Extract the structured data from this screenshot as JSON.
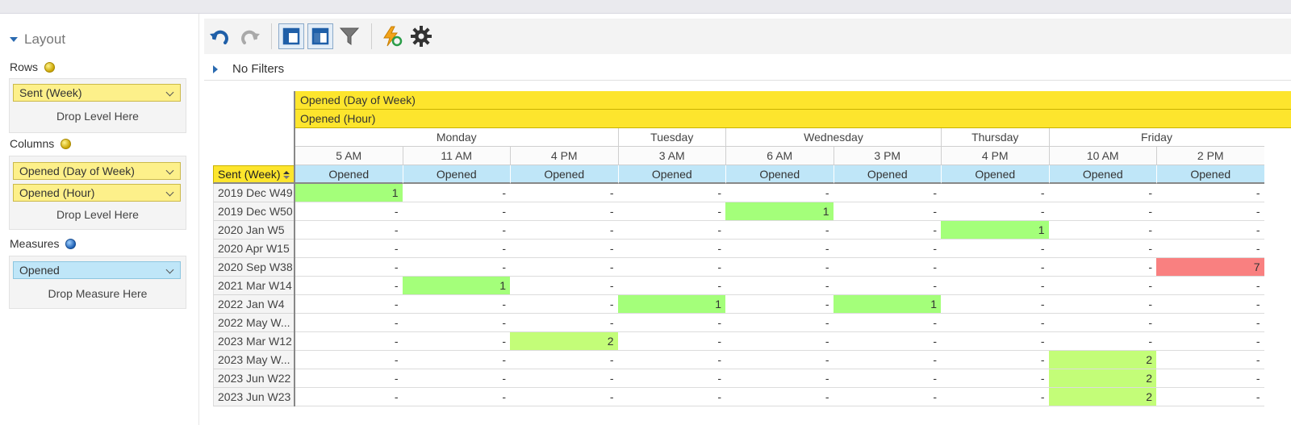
{
  "layout_panel": {
    "title": "Layout",
    "rows": {
      "label": "Rows",
      "chips": [
        "Sent (Week)"
      ],
      "drop_hint": "Drop Level Here"
    },
    "columns": {
      "label": "Columns",
      "chips": [
        "Opened (Day of Week)",
        "Opened (Hour)"
      ],
      "drop_hint": "Drop Level Here"
    },
    "measures": {
      "label": "Measures",
      "chips": [
        "Opened"
      ],
      "drop_hint": "Drop Measure Here"
    }
  },
  "toolbar": {
    "icons": [
      "undo-icon",
      "redo-icon",
      "compact-layout-icon",
      "tabular-layout-icon",
      "filter-icon",
      "refresh-icon",
      "settings-icon"
    ]
  },
  "filters": {
    "label": "No Filters"
  },
  "pivot": {
    "column_level_1": "Opened (Day of Week)",
    "column_level_2": "Opened (Hour)",
    "row_header": "Sent (Week)",
    "days": [
      {
        "name": "Monday",
        "span": 3
      },
      {
        "name": "Tuesday",
        "span": 1
      },
      {
        "name": "Wednesday",
        "span": 2
      },
      {
        "name": "Thursday",
        "span": 1
      },
      {
        "name": "Friday",
        "span": 2
      }
    ],
    "hours": [
      "5 AM",
      "11 AM",
      "4 PM",
      "3 AM",
      "6 AM",
      "3 PM",
      "4 PM",
      "10 AM",
      "2 PM"
    ],
    "measure": "Opened",
    "rows": [
      {
        "label": "2019 Dec W49",
        "values": [
          "1",
          "-",
          "-",
          "-",
          "-",
          "-",
          "-",
          "-",
          "-"
        ]
      },
      {
        "label": "2019 Dec W50",
        "values": [
          "-",
          "-",
          "-",
          "-",
          "1",
          "-",
          "-",
          "-",
          "-"
        ]
      },
      {
        "label": "2020 Jan W5",
        "values": [
          "-",
          "-",
          "-",
          "-",
          "-",
          "-",
          "1",
          "-",
          "-"
        ]
      },
      {
        "label": "2020 Apr W15",
        "values": [
          "-",
          "-",
          "-",
          "-",
          "-",
          "-",
          "-",
          "-",
          "-"
        ]
      },
      {
        "label": "2020 Sep W38",
        "values": [
          "-",
          "-",
          "-",
          "-",
          "-",
          "-",
          "-",
          "-",
          "7"
        ]
      },
      {
        "label": "2021 Mar W14",
        "values": [
          "-",
          "1",
          "-",
          "-",
          "-",
          "-",
          "-",
          "-",
          "-"
        ]
      },
      {
        "label": "2022 Jan W4",
        "values": [
          "-",
          "-",
          "-",
          "1",
          "-",
          "1",
          "-",
          "-",
          "-"
        ]
      },
      {
        "label": "2022 May W...",
        "values": [
          "-",
          "-",
          "-",
          "-",
          "-",
          "-",
          "-",
          "-",
          "-"
        ]
      },
      {
        "label": "2023 Mar W12",
        "values": [
          "-",
          "-",
          "2",
          "-",
          "-",
          "-",
          "-",
          "-",
          "-"
        ]
      },
      {
        "label": "2023 May W...",
        "values": [
          "-",
          "-",
          "-",
          "-",
          "-",
          "-",
          "-",
          "2",
          "-"
        ]
      },
      {
        "label": "2023 Jun W22",
        "values": [
          "-",
          "-",
          "-",
          "-",
          "-",
          "-",
          "-",
          "2",
          "-"
        ]
      },
      {
        "label": "2023 Jun W23",
        "values": [
          "-",
          "-",
          "-",
          "-",
          "-",
          "-",
          "-",
          "2",
          "-"
        ]
      }
    ],
    "highlight_colors": {
      "1": "#a4ff7a",
      "2": "#c3fd78",
      "7": "#f98080"
    }
  }
}
